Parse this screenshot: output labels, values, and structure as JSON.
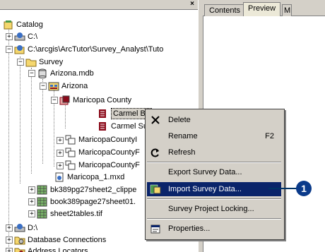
{
  "tree": {
    "close_glyph": "×",
    "items": [
      {
        "label": "Catalog"
      },
      {
        "label": "C:\\"
      },
      {
        "label": "C:\\arcgis\\ArcTutor\\Survey_Analyst\\Tuto"
      },
      {
        "label": "Survey"
      },
      {
        "label": "Arizona.mdb"
      },
      {
        "label": "Arizona"
      },
      {
        "label": "Maricopa County"
      },
      {
        "label": "Carmel Ba"
      },
      {
        "label": "Carmel Su"
      },
      {
        "label": "MaricopaCountyI"
      },
      {
        "label": "MaricopaCountyF"
      },
      {
        "label": "MaricopaCountyF"
      },
      {
        "label": "Maricopa_1.mxd"
      },
      {
        "label": "bk389pg27sheet2_clippe"
      },
      {
        "label": "book389page27sheet01."
      },
      {
        "label": "sheet2tables.tif"
      },
      {
        "label": "D:\\"
      },
      {
        "label": "Database Connections"
      },
      {
        "label": "Address Locators"
      }
    ]
  },
  "right_pane": {
    "tabs": [
      {
        "label": "Contents"
      },
      {
        "label": "Preview"
      },
      {
        "label": "M"
      }
    ]
  },
  "context_menu": {
    "items": [
      {
        "label": "Delete",
        "shortcut": ""
      },
      {
        "label": "Rename",
        "shortcut": "F2"
      },
      {
        "label": "Refresh",
        "shortcut": ""
      },
      {
        "label": "Export Survey Data...",
        "shortcut": ""
      },
      {
        "label": "Import Survey Data...",
        "shortcut": ""
      },
      {
        "label": "Survey Project Locking...",
        "shortcut": ""
      },
      {
        "label": "Properties...",
        "shortcut": ""
      }
    ],
    "highlighted_index": 4
  },
  "callout": {
    "number": "1"
  },
  "colors": {
    "selection": "#0a246a",
    "callout": "#0a3a8a",
    "folder": "#f5d76e",
    "sheet_red": "#8b0a1a"
  }
}
